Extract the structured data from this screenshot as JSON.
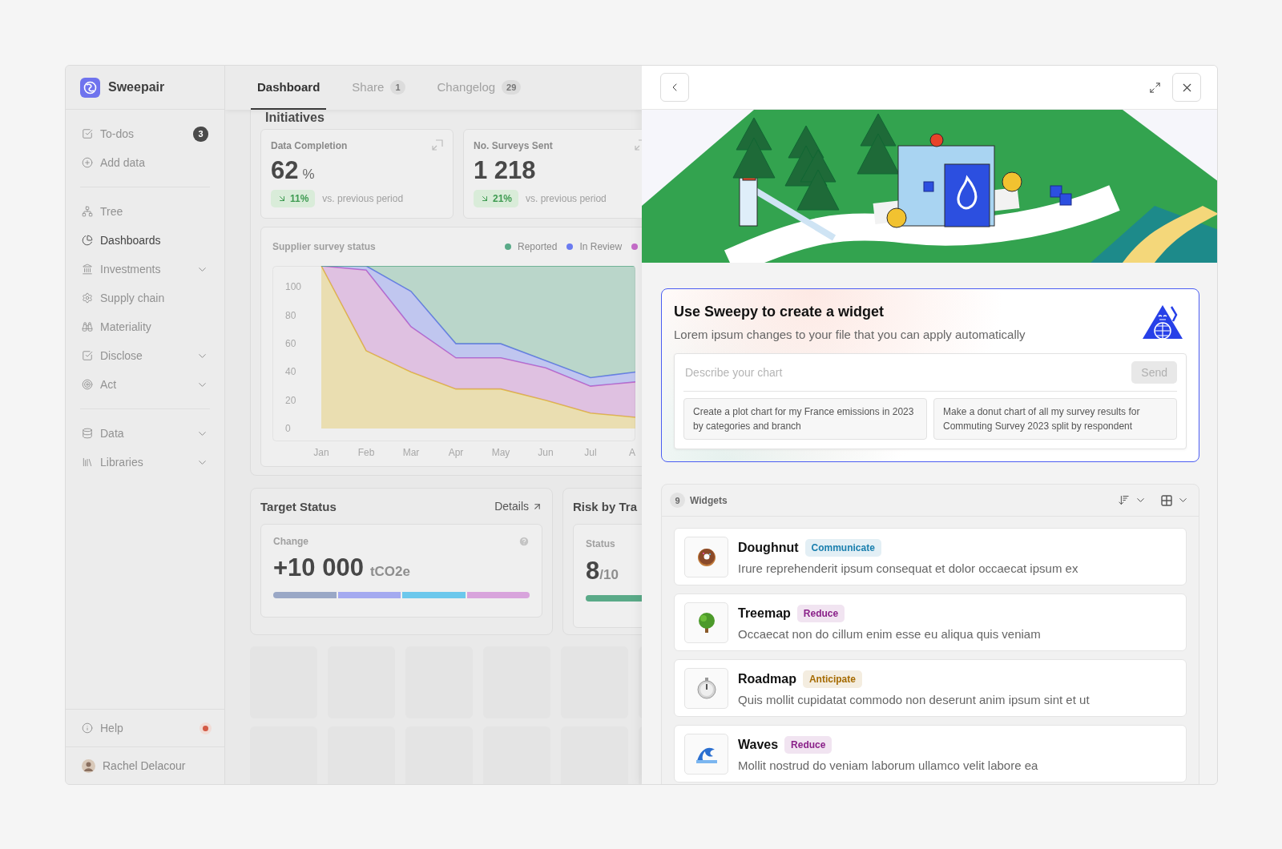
{
  "sidebar": {
    "brand": "Sweepair",
    "groups": [
      {
        "items": [
          {
            "label": "To-dos",
            "badge": "3",
            "selected": false,
            "expandable": false
          },
          {
            "label": "Add data",
            "selected": false,
            "expandable": false
          }
        ]
      },
      {
        "items": [
          {
            "label": "Tree",
            "selected": false,
            "expandable": false
          },
          {
            "label": "Dashboards",
            "selected": true,
            "expandable": false
          },
          {
            "label": "Investments",
            "selected": false,
            "expandable": true
          },
          {
            "label": "Supply chain",
            "selected": false,
            "expandable": false
          },
          {
            "label": "Materiality",
            "selected": false,
            "expandable": false
          },
          {
            "label": "Disclose",
            "selected": false,
            "expandable": true
          },
          {
            "label": "Act",
            "selected": false,
            "expandable": true
          }
        ]
      },
      {
        "items": [
          {
            "label": "Data",
            "selected": false,
            "expandable": true
          },
          {
            "label": "Libraries",
            "selected": false,
            "expandable": true
          }
        ]
      }
    ],
    "footer": {
      "help": {
        "label": "Help",
        "notification": true
      },
      "user": {
        "name": "Rachel Delacour"
      }
    }
  },
  "tabs": [
    {
      "label": "Dashboard",
      "selected": true
    },
    {
      "label": "Share",
      "count": "1",
      "selected": false
    },
    {
      "label": "Changelog",
      "count": "29",
      "selected": false
    }
  ],
  "dashboard": {
    "section_title": "Initiatives",
    "kpis": [
      {
        "title": "Data Completion",
        "value": "62",
        "unit": "%",
        "change": "11%",
        "comparison": "vs. previous period"
      },
      {
        "title": "No. Surveys Sent",
        "value": "1 218",
        "change": "21%",
        "comparison": "vs. previous period"
      }
    ],
    "survey_chart": {
      "title": "Supplier survey status",
      "chart_data": {
        "type": "area",
        "categories": [
          "Jan",
          "Feb",
          "Mar",
          "Apr",
          "May",
          "Jun",
          "Jul",
          "A"
        ],
        "ylim": [
          -9,
          115
        ],
        "yticks": [
          0,
          20,
          40,
          60,
          80,
          100
        ],
        "stacked": true,
        "series": [
          {
            "color": "#e3c040",
            "values": [
              115,
              55,
              40,
              28,
              28,
              20,
              11,
              8
            ]
          },
          {
            "color": "#c46cc8",
            "values": [
              0,
              57,
              32,
              22,
              22,
              23,
              19,
              25
            ]
          },
          {
            "name": "In Review",
            "color": "#6b7bf0",
            "values": [
              0,
              3,
              25,
              10,
              10,
              5,
              6,
              7
            ]
          },
          {
            "name": "Reported",
            "color": "#5aaa88",
            "values": [
              0,
              0,
              18,
              55,
              55,
              67,
              79,
              75
            ]
          }
        ]
      }
    },
    "target_status": {
      "title": "Target Status",
      "link": "Details",
      "metric": {
        "label": "Change",
        "value": "+10 000",
        "unit": "tCO2e",
        "segments": [
          {
            "color": "#9aa8c6"
          },
          {
            "color": "#a4aaf0"
          },
          {
            "color": "#6cc8ec"
          },
          {
            "color": "#d8a4dc"
          }
        ]
      }
    },
    "risk": {
      "title": "Risk by Tra",
      "metric": {
        "label": "Status",
        "value": "8",
        "total": "/10",
        "level": 0.8
      }
    }
  },
  "panel": {
    "assistant": {
      "title": "Use Sweepy to create a widget",
      "subtitle": "Lorem ipsum changes to your file that you can apply automatically",
      "placeholder": "Describe your chart",
      "send": {
        "label": "Send",
        "disabled": true
      },
      "suggestions": [
        "Create a plot chart for my France emissions in 2023 by categories and branch",
        "Make a donut chart of all my survey results for Commuting Survey 2023 split by respondent"
      ]
    },
    "widgets": {
      "count": "9",
      "label": "Widgets",
      "items": [
        {
          "title": "Doughnut",
          "tag": "Communicate",
          "color": "#1a7fae",
          "description": "Irure reprehenderit ipsum consequat et dolor occaecat ipsum ex"
        },
        {
          "title": "Treemap",
          "tag": "Reduce",
          "color": "#8a2189",
          "description": "Occaecat non do cillum enim esse eu aliqua quis veniam"
        },
        {
          "title": "Roadmap",
          "tag": "Anticipate",
          "color": "#a56a00",
          "description": "Quis mollit cupidatat commodo non deserunt anim ipsum sint et ut"
        },
        {
          "title": "Waves",
          "tag": "Reduce",
          "color": "#8a2189",
          "description": "Mollit nostrud do veniam laborum ullamco velit labore ea"
        }
      ]
    }
  }
}
